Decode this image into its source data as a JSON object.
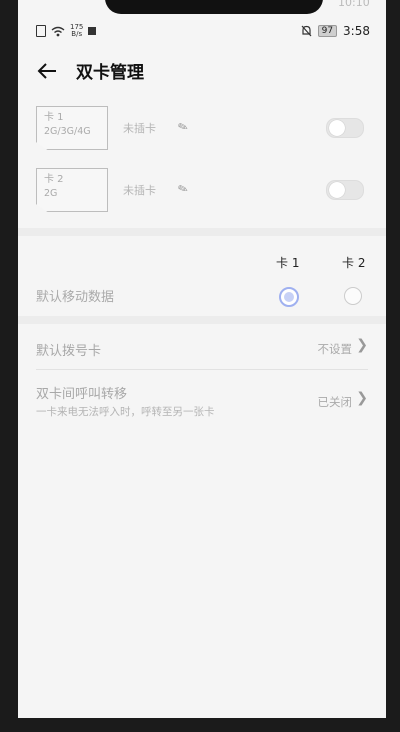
{
  "statusbar": {
    "net_speed_top": "175",
    "net_speed_bottom": "B/s",
    "battery": "97",
    "time": "3:58",
    "top_clock": "10:10"
  },
  "header": {
    "title": "双卡管理"
  },
  "sims": [
    {
      "label": "卡 1",
      "types": "2G/3G/4G",
      "status": "未插卡"
    },
    {
      "label": "卡 2",
      "types": "2G",
      "status": "未插卡"
    }
  ],
  "columns": {
    "card1": "卡 1",
    "card2": "卡 2"
  },
  "default_data": {
    "label": "默认移动数据",
    "selected": "card1"
  },
  "default_dial": {
    "label": "默认拨号卡",
    "value": "不设置"
  },
  "call_forward": {
    "label": "双卡间呼叫转移",
    "sub": "一卡来电无法呼入时，呼转至另一张卡",
    "value": "已关闭"
  },
  "icons": {
    "back": "arrow-left-icon",
    "edit": "pencil-icon",
    "chevron": "chevron-right-icon",
    "mute": "bell-off-icon",
    "wifi": "wifi-icon"
  },
  "colors": {
    "accent_radio": "#9fb0f0",
    "background": "#f5f5f5"
  }
}
